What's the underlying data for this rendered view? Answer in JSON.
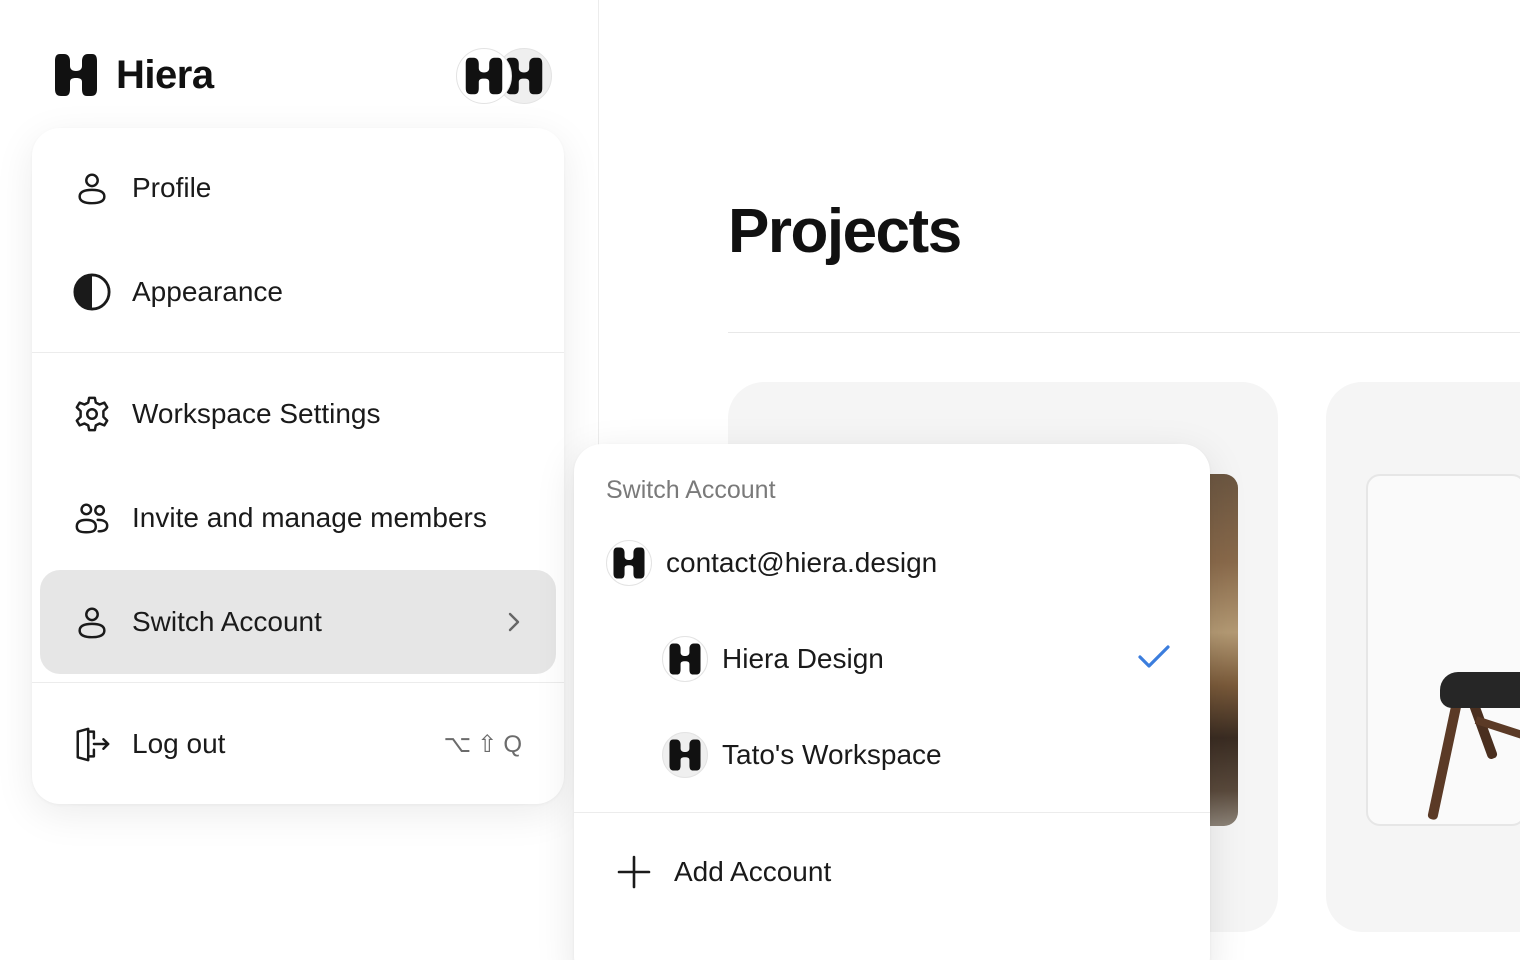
{
  "brand": {
    "name": "Hiera",
    "logo_icon": "hiera-logo-icon"
  },
  "header": {
    "avatars": [
      "account-avatar",
      "workspace-avatar"
    ]
  },
  "menu": {
    "items": [
      {
        "label": "Profile",
        "icon": "person-icon"
      },
      {
        "label": "Appearance",
        "icon": "half-circle-icon"
      },
      {
        "label": "Workspace Settings",
        "icon": "gear-icon"
      },
      {
        "label": "Invite and manage members",
        "icon": "people-icon"
      },
      {
        "label": "Switch Account",
        "icon": "person-icon",
        "active": true
      },
      {
        "label": "Log out",
        "icon": "logout-icon",
        "shortcut": "⌥⇧Q"
      }
    ]
  },
  "main": {
    "title": "Projects"
  },
  "switch_account": {
    "heading": "Switch Account",
    "account_email": "contact@hiera.design",
    "workspaces": [
      {
        "label": "Hiera Design",
        "selected": true
      },
      {
        "label": "Tato's Workspace",
        "selected": false
      }
    ],
    "add_label": "Add Account"
  },
  "colors": {
    "accent": "#3b7ddd",
    "active_bg": "#e6e6e6",
    "muted_text": "#7a7a7a"
  }
}
